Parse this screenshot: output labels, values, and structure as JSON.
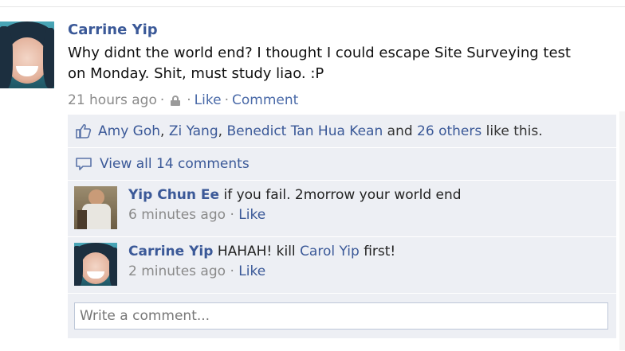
{
  "post": {
    "author": "Carrine Yip",
    "text": "Why didnt the world end? I thought I could escape Site Surveying test on Monday. Shit, must study liao. :P",
    "time": "21 hours ago",
    "separator": "·",
    "like_label": "Like",
    "comment_label": "Comment"
  },
  "likes": {
    "people": [
      "Amy Goh",
      "Zi Yang",
      "Benedict Tan Hua Kean"
    ],
    "comma": ",",
    "and_text": "and",
    "others": "26 others",
    "suffix": "like this."
  },
  "view_all": {
    "label": "View all 14 comments"
  },
  "comments": [
    {
      "name": "Yip Chun Ee",
      "text": "if you fail. 2morrow your world end",
      "time": "6 minutes ago",
      "like_label": "Like"
    },
    {
      "name": "Carrine Yip",
      "text_before": "HAHAH! kill",
      "mention": "Carol Yip",
      "text_after": "first!",
      "time": "2 minutes ago",
      "like_label": "Like"
    }
  ],
  "composer": {
    "placeholder": "Write a comment..."
  },
  "icons": {
    "privacy": "lock-icon",
    "likes": "like-thumb-icon",
    "comments": "comment-bubble-icon"
  },
  "colors": {
    "link": "#3b5998",
    "ufi_background": "#edeff4",
    "meta_text": "#8a8a8a"
  }
}
